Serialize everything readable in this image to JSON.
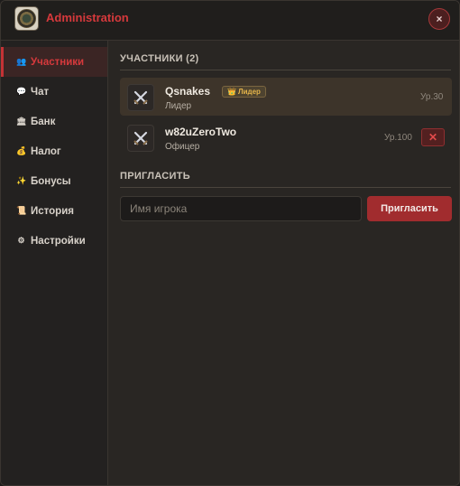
{
  "header": {
    "title": "Administration",
    "close_label": "×",
    "logo_icon": "guild-emblem-icon"
  },
  "sidebar": {
    "items": [
      {
        "label": "Участники",
        "icon": "👥",
        "active": true
      },
      {
        "label": "Чат",
        "icon": "💬",
        "active": false
      },
      {
        "label": "Банк",
        "icon": "🏛",
        "active": false
      },
      {
        "label": "Налог",
        "icon": "💰",
        "active": false
      },
      {
        "label": "Бонусы",
        "icon": "✨",
        "active": false
      },
      {
        "label": "История",
        "icon": "📜",
        "active": false
      },
      {
        "label": "Настройки",
        "icon": "⚙",
        "active": false
      }
    ]
  },
  "members": {
    "title": "УЧАСТНИКИ (2)",
    "list": [
      {
        "name": "Qsnakes",
        "role": "Лидер",
        "badge": "Лидер",
        "badge_icon": "👑",
        "level": "Ур.30",
        "kickable": false
      },
      {
        "name": "w82uZeroTwo",
        "role": "Офицер",
        "badge": "",
        "level": "Ур.100",
        "kickable": true,
        "kick_label": "✕"
      }
    ]
  },
  "invite": {
    "title": "ПРИГЛАСИТЬ",
    "placeholder": "Имя игрока",
    "button_label": "Пригласить"
  },
  "colors": {
    "accent": "#d6393c",
    "button": "#a12c2e",
    "gold": "#e3b34a"
  }
}
